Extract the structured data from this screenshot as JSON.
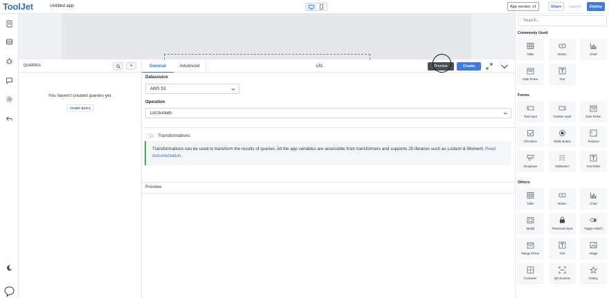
{
  "topbar": {
    "logo": "ToolJet",
    "app_name": "Untitled app",
    "version": "App version: v1",
    "share": "Share",
    "launch": "Launch",
    "deploy": "Deploy"
  },
  "queries": {
    "title": "QUERIES",
    "search_icon": "search-icon",
    "add": "+",
    "empty": "You haven't created queries yet.",
    "create": "create query"
  },
  "editor": {
    "tabs": [
      "General",
      "Advanced"
    ],
    "query_name": "s31",
    "preview": "Preview",
    "create": "Create",
    "datasource_label": "Datasource",
    "datasource_value": "AWS S3",
    "operation_label": "Operation",
    "operation_value": "List buckets",
    "transformations_label": "Transformations",
    "info_text": "Transformations can be used to transform the results of queries. All the app variables are accessible from transformers and supports JS libraries such as Lodash & Moment.",
    "info_link": "Read documentation.",
    "preview_label": "Preview"
  },
  "widgets": {
    "search_placeholder": "Search...",
    "sections": [
      {
        "title": "Commonly Used",
        "items": [
          "Table",
          "Button",
          "Chart",
          "Date Picker",
          "Text"
        ]
      },
      {
        "title": "Forms",
        "items": [
          "Text Input",
          "Number Input",
          "Date Picker",
          "Checkbox",
          "Radio Button",
          "Textarea",
          "Dropdown",
          "Multiselect",
          "Text Editor"
        ]
      },
      {
        "title": "Others",
        "items": [
          "Table",
          "Button",
          "Chart",
          "Modal",
          "Password Input",
          "Toggle Switch",
          "Range Picker",
          "Text",
          "Image",
          "Container",
          "QR Scanner",
          "Rating"
        ]
      }
    ]
  },
  "colors": {
    "brand": "#2f6fde",
    "deploy": "#3d7be6",
    "info_accent": "#2eb84d"
  }
}
